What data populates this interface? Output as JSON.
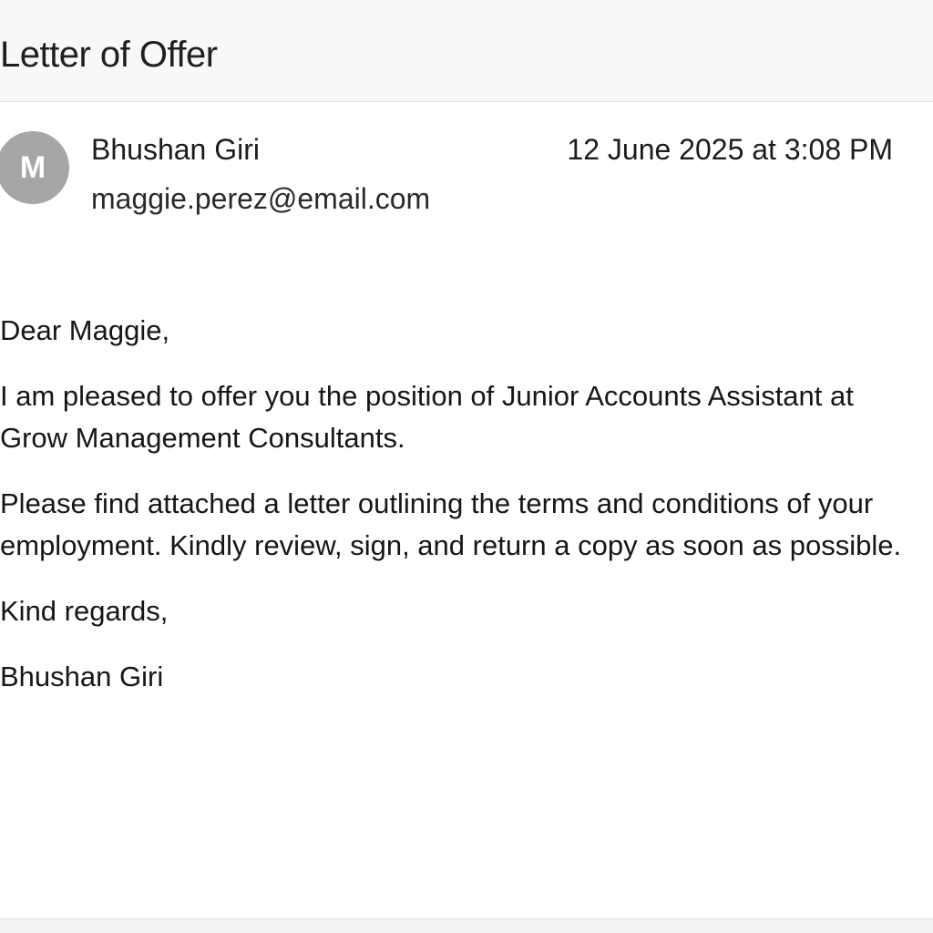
{
  "subject": "Letter of Offer",
  "sender": {
    "avatar_initial": "M",
    "name": "Bhushan Giri",
    "email": "maggie.perez@email.com"
  },
  "timestamp": "12 June 2025 at 3:08 PM",
  "body": {
    "greeting": "Dear Maggie,",
    "paragraph1": "I am pleased to offer you the position of Junior Accounts Assistant at Grow Management Consultants.",
    "paragraph2": "Please find attached a letter outlining the terms and conditions of your employment. Kindly review, sign, and return a copy as soon as possible.",
    "closing": "Kind regards,",
    "signature": "Bhushan Giri"
  },
  "colors": {
    "header_background": "#f9f8f6",
    "avatar_background": "#a6a6a6",
    "text": "#1c1c1c"
  }
}
